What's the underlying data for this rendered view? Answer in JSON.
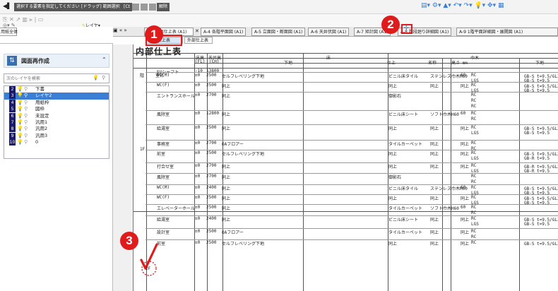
{
  "toolbar": {
    "msg1": "選択する要素を指定してください。",
    "msg2": "[ドラッグ] 範囲選択",
    "msg3": "[Ct",
    "msg4": "解除",
    "layer_btn": "レイヤ"
  },
  "tabs": [
    {
      "label": "用紙全体"
    },
    {
      "label": "A-3 内部仕上表 (A1)"
    },
    {
      "label": "A-4 各階平面図 (A1)"
    },
    {
      "label": "A-5 立面図・断面図 (A1)"
    },
    {
      "label": "A-6 天井伏図 (A1)"
    },
    {
      "label": "A-7 矩計図 (A1)"
    },
    {
      "label": "A-8 階段廻り詳細図 (A1)"
    },
    {
      "label": "A-9 1階平面詳細図・展開図 (A1)"
    }
  ],
  "subtabs": {
    "internal": "内部仕上表",
    "external": "外部仕上表"
  },
  "panel": {
    "title": "図面再作成",
    "search_placeholder": "次のレイヤを検索"
  },
  "layers": [
    {
      "num": "2",
      "name": "下書"
    },
    {
      "num": "3",
      "name": "レイヤ2"
    },
    {
      "num": "4",
      "name": "用紙枠"
    },
    {
      "num": "5",
      "name": "図枠"
    },
    {
      "num": "6",
      "name": "未設定"
    },
    {
      "num": "7",
      "name": "汎用1"
    },
    {
      "num": "8",
      "name": "汎用2"
    },
    {
      "num": "9",
      "name": "汎用3"
    },
    {
      "num": "10",
      "name": "0"
    }
  ],
  "sheet": {
    "title": "内部仕上表"
  },
  "table": {
    "headers": {
      "floor": "階",
      "room": "室名",
      "fl": "床高",
      "fl_unit": "(FL)",
      "ch": "天井高",
      "ch_unit": "(CH)",
      "floor_group": "床",
      "base": "下地",
      "finish": "仕上",
      "wainscot": "巾木",
      "name": "名称",
      "height": "高さ mm",
      "base2": "下地"
    },
    "floors": [
      "1F",
      "2F"
    ],
    "rows": [
      {
        "room": "EVシャフト",
        "fl": "-10",
        "ch": "13800",
        "base": "",
        "finish": "",
        "ww_name": "",
        "ww_h": "",
        "b2": []
      },
      {
        "room": "WC(M)",
        "fl": "±0",
        "ch": "2500",
        "base": "セルフレベリング下地",
        "finish": "ビニル床タイル",
        "ww_name": "ステンレス巾木H60",
        "ww_h": "60",
        "b2": [
          "RC",
          "LGS"
        ],
        "b3": [
          "GB-S t=9.5/GL工法",
          "GB-S t=9.5"
        ]
      },
      {
        "room": "WC(F)",
        "fl": "±0",
        "ch": "2500",
        "base": "同上",
        "finish": "同上",
        "ww_name": "同上",
        "ww_h": "同上",
        "b2": [
          "RC",
          "LGS"
        ],
        "b3": [
          "GB-S t=9.5/GL工法",
          "GB-S t=9.5"
        ]
      },
      {
        "room": "エントランスホール",
        "fl": "±0",
        "ch": "2700",
        "base": "同上",
        "finish": "御影石",
        "ww_name": "",
        "ww_h": "",
        "b2": [
          "RC",
          "RC",
          "RC"
        ],
        "b3": []
      },
      {
        "room": "風除室",
        "fl": "±0",
        "ch": "12800",
        "base": "同上",
        "finish": "ビニル床シート",
        "ww_name": "ソフト巾木H60",
        "ww_h": "60",
        "b2": [
          "RC",
          "RC"
        ],
        "b3": []
      },
      {
        "room": "給湯室",
        "fl": "±0",
        "ch": "2500",
        "base": "同上",
        "finish": "同上",
        "ww_name": "同上",
        "ww_h": "同上",
        "b2": [
          "RC",
          "LGS"
        ],
        "b3": [
          "GB-S t=9.5/GL工法",
          "GB-S t=9.5"
        ]
      },
      {
        "room": "事務室",
        "fl": "±0",
        "ch": "2700",
        "base": "OAフロアー",
        "finish": "タイルカーペット",
        "ww_name": "同上",
        "ww_h": "同上",
        "b2": [
          "RC",
          "RC"
        ],
        "b3": []
      },
      {
        "room": "前室",
        "fl": "±0",
        "ch": "2500",
        "base": "セルフレベリング下地",
        "finish": "同上",
        "ww_name": "同上",
        "ww_h": "同上",
        "b2": [
          "RC",
          "LGS"
        ],
        "b3": [
          "GB-S t=9.5/GL工法",
          "GB-R t=9.5"
        ]
      },
      {
        "room": "打合せ室",
        "fl": "±0",
        "ch": "2700",
        "base": "同上",
        "finish": "同上",
        "ww_name": "同上",
        "ww_h": "同上",
        "b2": [
          "RC",
          "LGS"
        ],
        "b3": [
          "GB-R t=9.5/GL工法",
          "GB-R t=9.5"
        ]
      },
      {
        "room": "風除室",
        "fl": "±0",
        "ch": "2700",
        "base": "同上",
        "finish": "御影石",
        "ww_name": "",
        "ww_h": "",
        "b2": [
          "RC",
          "RC"
        ],
        "b3": []
      },
      {
        "room": "WC(M)",
        "fl": "±0",
        "ch": "2400",
        "base": "同上",
        "finish": "ビニル床タイル",
        "ww_name": "ステンレス巾木H60",
        "ww_h": "60",
        "b2": [
          "RC",
          "LGS"
        ],
        "b3": [
          "GB-S t=9.5/GL工法",
          "GB-S t=9.5"
        ]
      },
      {
        "room": "WC(F)",
        "fl": "±0",
        "ch": "2500",
        "base": "同上",
        "finish": "同上",
        "ww_name": "同上",
        "ww_h": "同上",
        "b2": [
          "RC",
          "LGS"
        ],
        "b3": [
          "GB-S t=9.5/GL工法",
          "GB-S t=9.5"
        ]
      },
      {
        "room": "エレベーターホール",
        "fl": "±0",
        "ch": "2500",
        "base": "同上",
        "finish": "タイルカーペット",
        "ww_name": "ソフト巾木H60",
        "ww_h": "60",
        "b2": [
          "RC",
          "RC"
        ],
        "b3": []
      },
      {
        "room": "給湯室",
        "fl": "±0",
        "ch": "2400",
        "base": "同上",
        "finish": "ビニル床シート",
        "ww_name": "同上",
        "ww_h": "同上",
        "b2": [
          "RC",
          "LGS"
        ],
        "b3": [
          "GB-S t=9.5/GL工法",
          "GB-S t=9.5"
        ]
      },
      {
        "room": "設計室",
        "fl": "±0",
        "ch": "2500",
        "base": "OAフロアー",
        "finish": "タイルカーペット",
        "ww_name": "同上",
        "ww_h": "同上",
        "b2": [
          "RC",
          "RC"
        ],
        "b3": []
      },
      {
        "room": "前室",
        "fl": "±0",
        "ch": "2500",
        "base": "セルフレベリング下地",
        "finish": "同上",
        "ww_name": "同上",
        "ww_h": "同上",
        "b2": [
          "RC"
        ],
        "b3": [
          "GB-S t=9.5/GL工法"
        ]
      }
    ]
  },
  "callouts": [
    "1",
    "2",
    "3"
  ],
  "accent": "#e01b1b"
}
